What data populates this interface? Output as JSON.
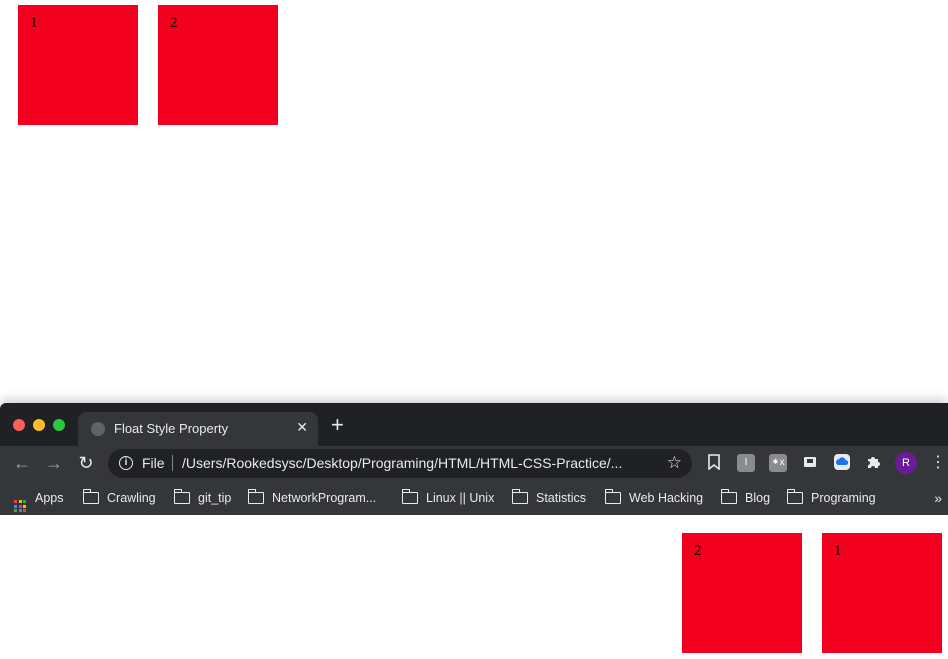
{
  "colors": {
    "box_fill": "#f3001e",
    "light_close": "#ff5f57",
    "light_minimize": "#febc2e",
    "light_zoom": "#28c840"
  },
  "page_top": {
    "boxes": [
      {
        "label": "1"
      },
      {
        "label": "2"
      }
    ]
  },
  "browser": {
    "tab": {
      "title": "Float Style Property",
      "favicon": "globe-icon",
      "close_icon": "close-icon"
    },
    "new_tab_icon": "plus-icon",
    "toolbar": {
      "back_icon": "arrow-left-icon",
      "forward_icon": "arrow-right-icon",
      "reload_icon": "reload-icon",
      "omnibox": {
        "scheme_label": "File",
        "url": "/Users/Rookedsysc/Desktop/Programing/HTML/HTML-CSS-Practice/...",
        "info_icon": "info-icon",
        "bookmark_star_icon": "star-icon"
      },
      "profile_initial": "R"
    },
    "bookmarks": [
      {
        "label": "Apps",
        "icon": "apps-grid-icon"
      },
      {
        "label": "Crawling",
        "icon": "folder-icon"
      },
      {
        "label": "git_tip",
        "icon": "folder-icon"
      },
      {
        "label": "NetworkProgram...",
        "icon": "folder-icon"
      },
      {
        "label": "Linux || Unix",
        "icon": "folder-icon"
      },
      {
        "label": "Statistics",
        "icon": "folder-icon"
      },
      {
        "label": "Web Hacking",
        "icon": "folder-icon"
      },
      {
        "label": "Blog",
        "icon": "folder-icon"
      },
      {
        "label": "Programing",
        "icon": "folder-icon"
      }
    ],
    "bookmarks_overflow": "»",
    "viewport": {
      "boxes": [
        {
          "label": "2"
        },
        {
          "label": "1"
        }
      ]
    }
  }
}
